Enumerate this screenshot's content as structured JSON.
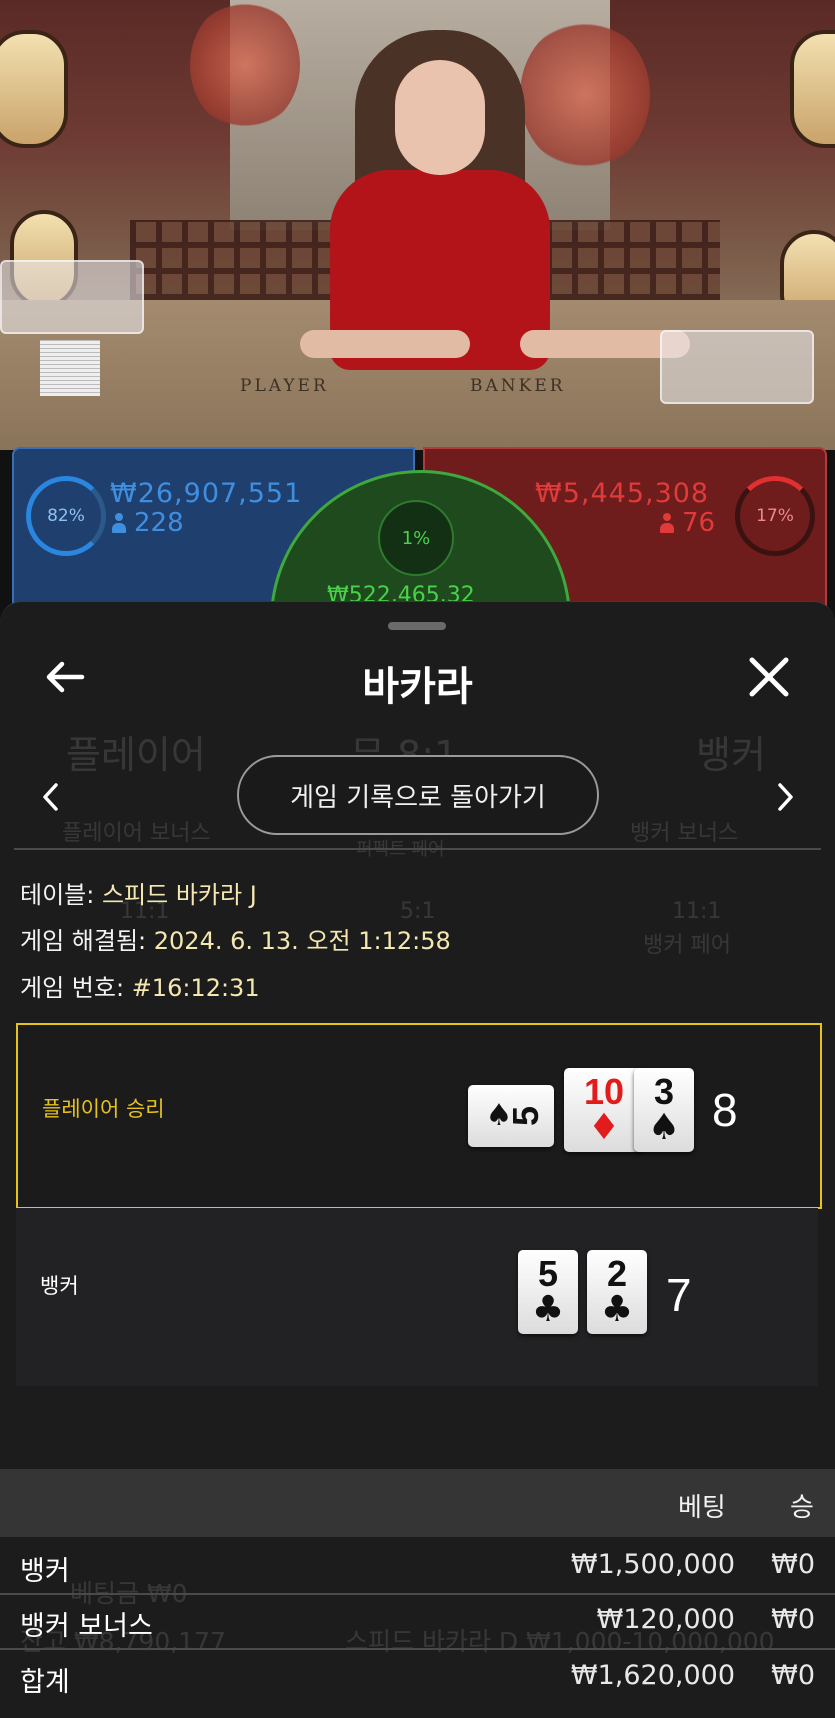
{
  "video": {
    "table_labels": {
      "player": "PLAYER",
      "banker": "BANKER"
    }
  },
  "bets": {
    "player": {
      "percent": "82%",
      "amount": "₩26,907,551",
      "players": "228",
      "color": "#2b86e0"
    },
    "banker": {
      "percent": "17%",
      "amount": "₩5,445,308",
      "players": "76",
      "color": "#e03030"
    },
    "tie": {
      "percent": "1%",
      "amount": "₩522,465.32",
      "color": "#3fa83f"
    }
  },
  "background_ghost": {
    "player": "플레이어",
    "tie": "무 8:1",
    "banker": "뱅커",
    "player_bonus": "플레이어 보너스",
    "perfect_pair": "퍼펙트 페어",
    "banker_bonus": "뱅커 보너스",
    "pair_left": "11:1",
    "pair_mid": "5:1",
    "pair_right": "11:1",
    "banker_pair": "뱅커 페어",
    "balance": "잔고 ₩8,790,177",
    "bet_total": "베팅금 ₩0",
    "table_limit": "스피드 바카라 D  ₩1,000-10,000,000"
  },
  "sheet": {
    "title": "바카라",
    "history_button": "게임 기록으로 돌아가기",
    "table_label": "테이블:",
    "table_value": "스피드 바카라 J",
    "resolved_label": "게임 해결됨:",
    "resolved_value": "2024. 6. 13. 오전 1:12:58",
    "game_no_label": "게임 번호:",
    "game_no_value": "#16:12:31"
  },
  "hands": {
    "player": {
      "label": "플레이어 승리",
      "label_color": "#e6c21c",
      "score": "8",
      "cards": [
        {
          "rank": "5",
          "suit": "♠",
          "color": "black",
          "rotated": true
        },
        {
          "rank": "10",
          "suit": "♦",
          "color": "red",
          "rotated": false
        },
        {
          "rank": "3",
          "suit": "♠",
          "color": "black",
          "rotated": false
        }
      ]
    },
    "banker": {
      "label": "뱅커",
      "score": "7",
      "cards": [
        {
          "rank": "5",
          "suit": "♣",
          "color": "black",
          "rotated": false
        },
        {
          "rank": "2",
          "suit": "♣",
          "color": "black",
          "rotated": false
        }
      ]
    }
  },
  "bets_table": {
    "headers": {
      "bet": "베팅",
      "win": "승"
    },
    "rows": [
      {
        "name": "뱅커",
        "bet": "₩1,500,000",
        "win": "₩0"
      },
      {
        "name": "뱅커 보너스",
        "bet": "₩120,000",
        "win": "₩0"
      },
      {
        "name": "합계",
        "bet": "₩1,620,000",
        "win": "₩0"
      }
    ]
  }
}
